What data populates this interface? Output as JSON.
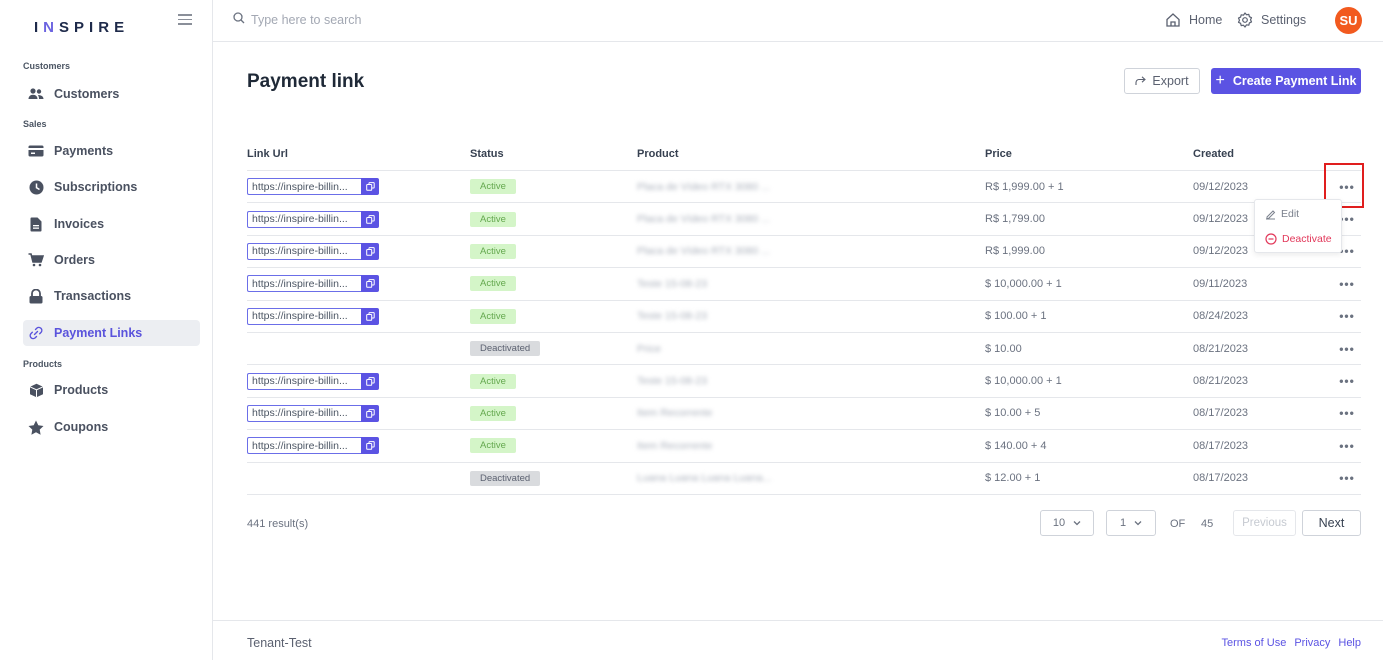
{
  "app": {
    "logo_text": "INSPIRE",
    "brand_color": "#5b53e3",
    "accent_orange": "#f25a1f"
  },
  "sidebar": {
    "sections": [
      {
        "label": "Customers"
      },
      {
        "label": "Sales"
      },
      {
        "label": "Products"
      }
    ],
    "items": [
      {
        "label": "Customers",
        "icon": "users-icon"
      },
      {
        "label": "Payments",
        "icon": "credit-card-icon"
      },
      {
        "label": "Subscriptions",
        "icon": "clock-icon"
      },
      {
        "label": "Invoices",
        "icon": "file-icon"
      },
      {
        "label": "Orders",
        "icon": "cart-icon"
      },
      {
        "label": "Transactions",
        "icon": "lock-icon"
      },
      {
        "label": "Payment Links",
        "icon": "link-icon",
        "active": true
      },
      {
        "label": "Products",
        "icon": "box-icon"
      },
      {
        "label": "Coupons",
        "icon": "star-icon"
      }
    ]
  },
  "topbar": {
    "search_placeholder": "Type here to search",
    "home_label": "Home",
    "settings_label": "Settings",
    "avatar_initials": "SU"
  },
  "main": {
    "title": "Payment link",
    "export_label": "Export",
    "create_label": "Create Payment Link"
  },
  "table": {
    "columns": [
      "Link Url",
      "Status",
      "Product",
      "Price",
      "Created"
    ],
    "rows": [
      {
        "link": "https://inspire-billin...",
        "status": "Active",
        "product": "Placa de Vídeo RTX 3080 ...",
        "price": "R$ 1,999.00 + 1",
        "created": "09/12/2023"
      },
      {
        "link": "https://inspire-billin...",
        "status": "Active",
        "product": "Placa de Vídeo RTX 3080 ...",
        "price": "R$ 1,799.00",
        "created": "09/12/2023"
      },
      {
        "link": "https://inspire-billin...",
        "status": "Active",
        "product": "Placa de Vídeo RTX 3080 ...",
        "price": "R$ 1,999.00",
        "created": "09/12/2023"
      },
      {
        "link": "https://inspire-billin...",
        "status": "Active",
        "product": "Teste 15-08-23",
        "price": "$ 10,000.00 + 1",
        "created": "09/11/2023"
      },
      {
        "link": "https://inspire-billin...",
        "status": "Active",
        "product": "Teste 15-08-23",
        "price": "$ 100.00 + 1",
        "created": "08/24/2023"
      },
      {
        "link": "",
        "status": "Deactivated",
        "product": "Price",
        "price": "$ 10.00",
        "created": "08/21/2023"
      },
      {
        "link": "https://inspire-billin...",
        "status": "Active",
        "product": "Teste 15-08-23",
        "price": "$ 10,000.00 + 1",
        "created": "08/21/2023"
      },
      {
        "link": "https://inspire-billin...",
        "status": "Active",
        "product": "Item Recorrente",
        "price": "$ 10.00 + 5",
        "created": "08/17/2023"
      },
      {
        "link": "https://inspire-billin...",
        "status": "Active",
        "product": "Item Recorrente",
        "price": "$ 140.00 + 4",
        "created": "08/17/2023"
      },
      {
        "link": "",
        "status": "Deactivated",
        "product": "Luana Luana Luana Luana...",
        "price": "$ 12.00 + 1",
        "created": "08/17/2023"
      }
    ],
    "actions_glyph": "•••"
  },
  "row_menu": {
    "edit_label": "Edit",
    "deactivate_label": "Deactivate"
  },
  "pagination": {
    "results_text": "441 result(s)",
    "page_size": "10",
    "current_page": "1",
    "of_label": "OF",
    "total_pages": "45",
    "prev_label": "Previous",
    "next_label": "Next"
  },
  "footer": {
    "tenant": "Tenant-Test",
    "links": [
      "Terms of Use",
      "Privacy",
      "Help"
    ]
  }
}
